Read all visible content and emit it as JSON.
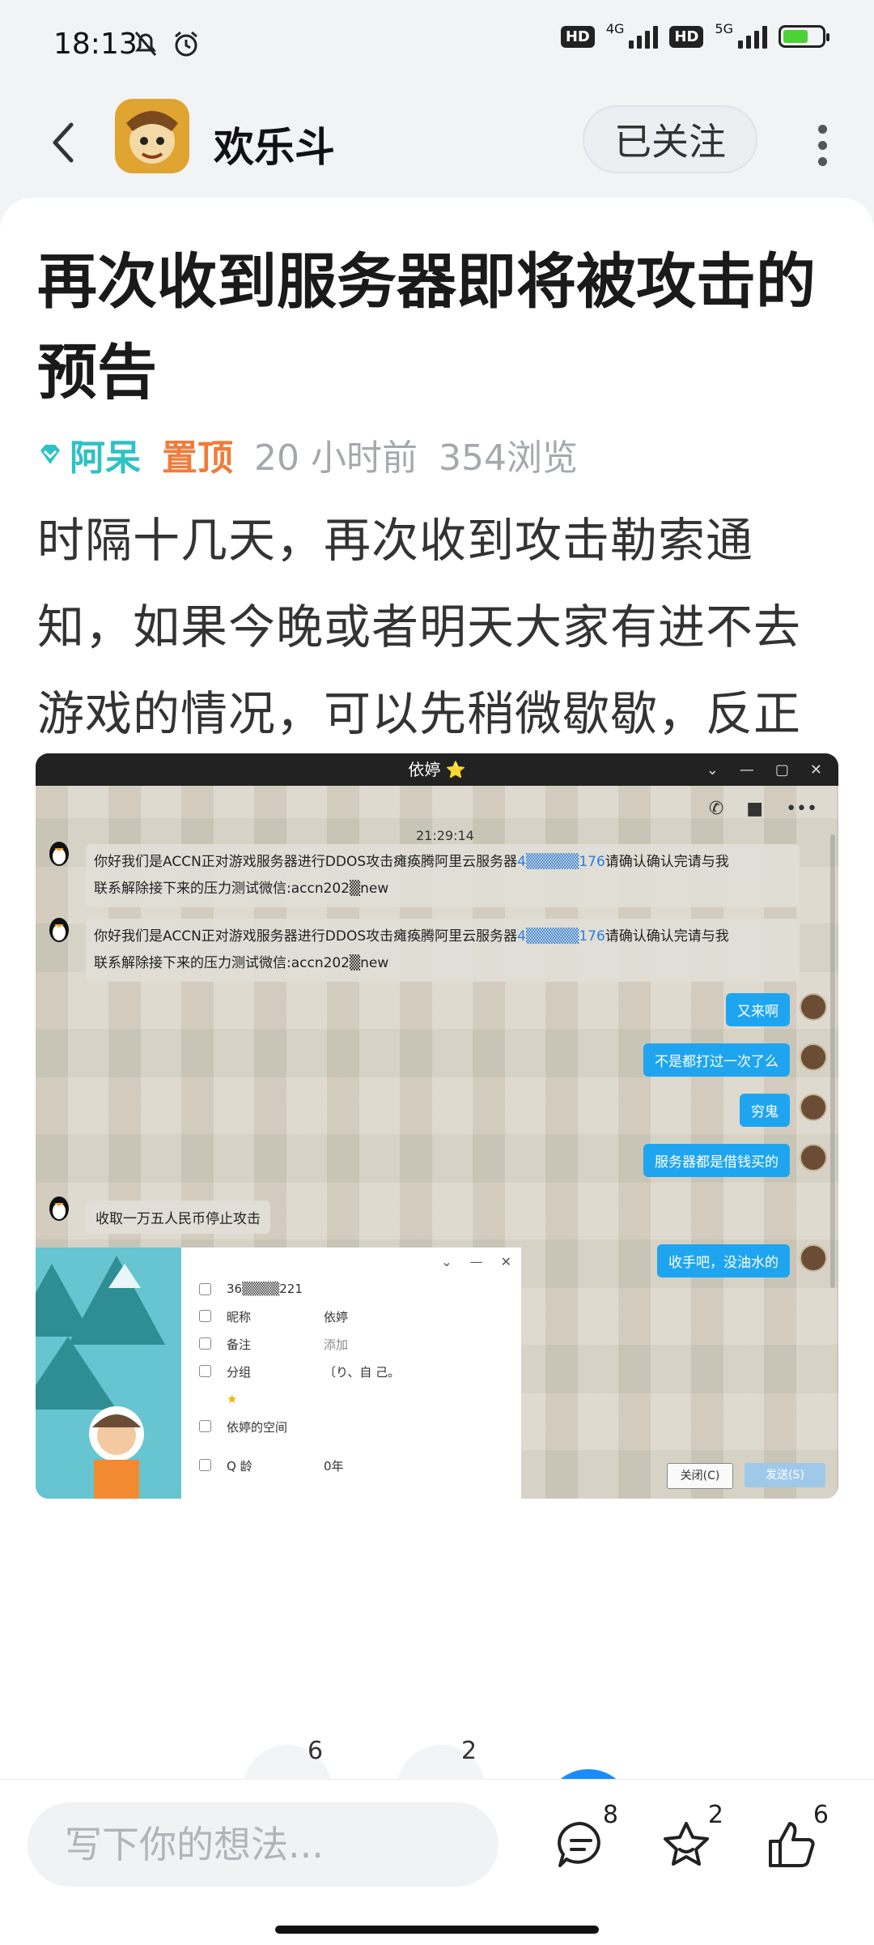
{
  "status_bar": {
    "time": "18:13",
    "network_1": "4G",
    "network_2": "5G",
    "hd_label": "HD"
  },
  "header": {
    "app_name": "欢乐斗",
    "follow_label": "已关注"
  },
  "post": {
    "title": "再次收到服务器即将被攻击的预告",
    "author": "阿呆",
    "pinned": "置顶",
    "time_ago": "20 小时前",
    "views": "354浏览",
    "body": "时隔十几天，再次收到攻击勒索通知，如果今晚或者明天大家有进不去游戏的情况，可以先稍微歇歇，反正我也没钱和解，咱们就先躺一会，消停等完了咱们再唠"
  },
  "screenshot": {
    "window_title": "依婷 ⭐",
    "timestamp": "21:29:14",
    "incoming": [
      {
        "pre": "你好我们是ACCN正对游戏服务器进行DDOS攻击瘫痪腾阿里云服务器",
        "ip": "4▒▒▒▒▒176",
        "post": "请确认确认完请与我",
        "line2": "联系解除接下来的压力测试微信:accn202▒new"
      },
      {
        "pre": "你好我们是ACCN正对游戏服务器进行DDOS攻击瘫痪腾阿里云服务器",
        "ip": "4▒▒▒▒▒176",
        "post": "请确认确认完请与我",
        "line2": "联系解除接下来的压力测试微信:accn202▒new"
      }
    ],
    "outgoing": [
      "又来啊",
      "不是都打过一次了么",
      "穷鬼",
      "服务器都是借钱买的",
      "收手吧，没油水的"
    ],
    "incoming_short": "收取一万五人民币停止攻击",
    "profile": {
      "qq": "36▒▒▒▒221",
      "nickname_key": "昵称",
      "nickname_val": "依婷",
      "remark_key": "备注",
      "remark_val": "添加",
      "group_key": "分组",
      "group_val": "〔り、自 己。",
      "space": "依婷的空间",
      "qage_key": "Q 龄",
      "qage_val": "0年"
    },
    "close_btn": "关闭(C)",
    "send_btn": "发送(S)"
  },
  "reactions": {
    "like_count": "6",
    "second_count": "2"
  },
  "bottom_bar": {
    "placeholder": "写下你的想法...",
    "comments": "8",
    "favorites": "2",
    "likes": "6"
  },
  "colors": {
    "author": "#2ec2c5",
    "pinned": "#f07c3a",
    "bubble_out": "#1fa5f0"
  }
}
